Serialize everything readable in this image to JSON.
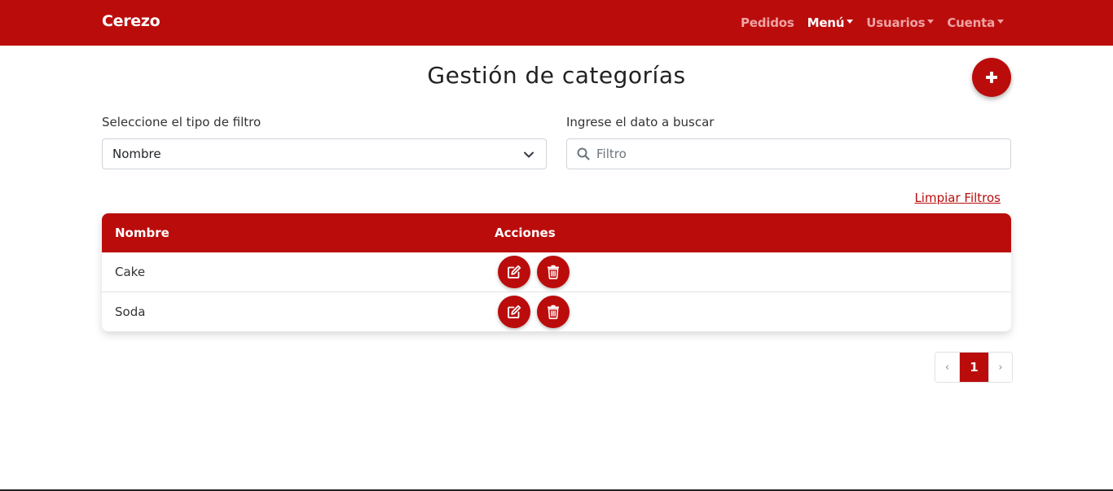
{
  "navbar": {
    "brand": "Cerezo",
    "links": [
      {
        "label": "Pedidos"
      },
      {
        "label": "Menú"
      },
      {
        "label": "Usuarios"
      },
      {
        "label": "Cuenta"
      }
    ]
  },
  "page": {
    "title": "Gestión de categorías"
  },
  "filters": {
    "type_label": "Seleccione el tipo de filtro",
    "type_value": "Nombre",
    "search_label": "Ingrese el dato a buscar",
    "search_placeholder": "Filtro",
    "search_value": "",
    "clear_label": "Limpiar Filtros"
  },
  "table": {
    "headers": [
      "Nombre",
      "Acciones"
    ],
    "rows": [
      {
        "name": "Cake"
      },
      {
        "name": "Soda"
      }
    ]
  },
  "pagination": {
    "prev": "‹",
    "current": "1",
    "next": "›"
  },
  "colors": {
    "brand": "#bb0c0c",
    "nav_inactive": "#f0a3a3",
    "text": "#212529"
  },
  "icons": {
    "add": "plus-icon",
    "edit": "edit-icon",
    "delete": "trash-icon",
    "search": "search-icon",
    "select": "chevron-down-icon"
  }
}
